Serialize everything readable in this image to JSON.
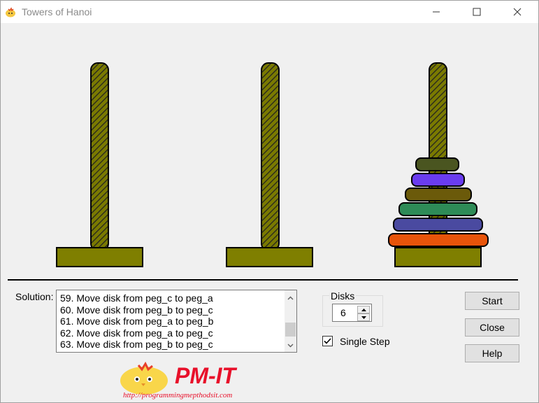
{
  "window": {
    "title": "Towers of Hanoi",
    "controls": [
      "minimize-icon",
      "maximize-icon",
      "close-icon"
    ]
  },
  "pegs": [
    "peg_a",
    "peg_b",
    "peg_c"
  ],
  "disks_on_peg_c_top_to_bottom": [
    {
      "size": 1,
      "color": "#4a5520"
    },
    {
      "size": 2,
      "color": "#6a3cf0"
    },
    {
      "size": 3,
      "color": "#6b5a0a"
    },
    {
      "size": 4,
      "color": "#2e8b57"
    },
    {
      "size": 5,
      "color": "#4a4aa0"
    },
    {
      "size": 6,
      "color": "#e8540a"
    }
  ],
  "colors": {
    "peg": "#7a7a00",
    "base": "#7f7f00"
  },
  "solution": {
    "label": "Solution:",
    "items": [
      "59. Move disk from peg_c to peg_a",
      "60. Move disk from peg_b to peg_c",
      "61. Move disk from peg_a to peg_b",
      "62. Move disk from peg_a to peg_c",
      "63. Move disk from peg_b to peg_c"
    ]
  },
  "disks": {
    "label": "Disks",
    "value": "6"
  },
  "single_step": {
    "label": "Single Step",
    "checked": true
  },
  "buttons": {
    "start": "Start",
    "close": "Close",
    "help": "Help"
  },
  "watermark": {
    "text": "PM-IT",
    "url": "http://programmingmepthodsit.com"
  }
}
